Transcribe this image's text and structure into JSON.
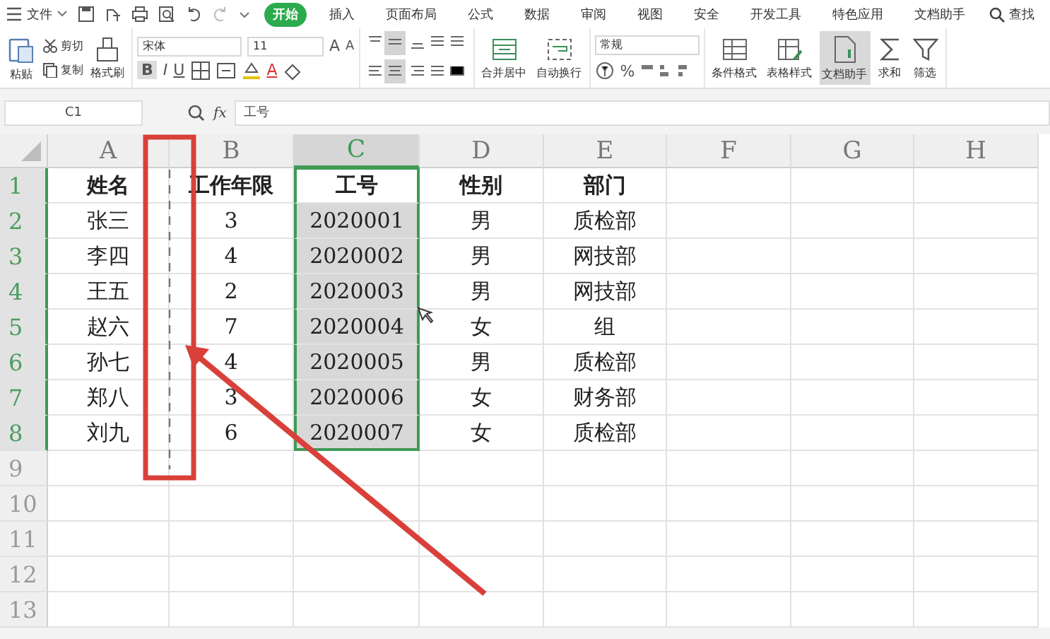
{
  "menu": {
    "file": "文件"
  },
  "tabs": [
    {
      "label": "开始",
      "selected": true
    },
    {
      "label": "插入",
      "selected": false
    },
    {
      "label": "页面布局",
      "selected": false
    },
    {
      "label": "公式",
      "selected": false
    },
    {
      "label": "数据",
      "selected": false
    },
    {
      "label": "审阅",
      "selected": false
    },
    {
      "label": "视图",
      "selected": false
    },
    {
      "label": "安全",
      "selected": false
    },
    {
      "label": "开发工具",
      "selected": false
    },
    {
      "label": "特色应用",
      "selected": false
    },
    {
      "label": "文档助手",
      "selected": false
    }
  ],
  "search": {
    "label": "查找"
  },
  "ribbon": {
    "paste": "粘贴",
    "cut": "剪切",
    "copy": "复制",
    "format_painter": "格式刷",
    "font": "宋体",
    "font_size": "11",
    "font_grow": "A",
    "font_shrink": "A",
    "bold": "B",
    "italic": "I",
    "underline": "U",
    "font_color": "A",
    "merge": "合并居中",
    "wrap": "自动换行",
    "number_format": "常规",
    "percent": "%",
    "conditional": "条件格式",
    "table_style": "表格样式",
    "doc_helper": {
      "label": "文档助手",
      "selected": true
    },
    "sum": "求和",
    "filter": "筛选"
  },
  "formula_bar": {
    "name_box": "C1",
    "fx": "fx",
    "formula": "工号"
  },
  "sheet": {
    "columns": [
      {
        "label": "A",
        "selected": false
      },
      {
        "label": "B",
        "selected": false
      },
      {
        "label": "C",
        "selected": true
      },
      {
        "label": "D",
        "selected": false
      },
      {
        "label": "E",
        "selected": false
      },
      {
        "label": "F",
        "selected": false
      },
      {
        "label": "G",
        "selected": false
      },
      {
        "label": "H",
        "selected": false
      }
    ],
    "rows": [
      {
        "number": "1",
        "selected": true,
        "bold": true,
        "cells": [
          "姓名",
          "工作年限",
          "工号",
          "性别",
          "部门"
        ]
      },
      {
        "number": "2",
        "selected": true,
        "bold": false,
        "cells": [
          "张三",
          "3",
          "2020001",
          "男",
          "质检部"
        ]
      },
      {
        "number": "3",
        "selected": true,
        "bold": false,
        "cells": [
          "李四",
          "4",
          "2020002",
          "男",
          "网技部"
        ]
      },
      {
        "number": "4",
        "selected": true,
        "bold": false,
        "cells": [
          "王五",
          "2",
          "2020003",
          "男",
          "网技部"
        ]
      },
      {
        "number": "5",
        "selected": true,
        "bold": false,
        "cells": [
          "赵六",
          "7",
          "2020004",
          "女",
          "组"
        ]
      },
      {
        "number": "6",
        "selected": true,
        "bold": false,
        "cells": [
          "孙七",
          "4",
          "2020005",
          "男",
          "质检部"
        ]
      },
      {
        "number": "7",
        "selected": true,
        "bold": false,
        "cells": [
          "郑八",
          "3",
          "2020006",
          "女",
          "财务部"
        ]
      },
      {
        "number": "8",
        "selected": true,
        "bold": false,
        "cells": [
          "刘九",
          "6",
          "2020007",
          "女",
          "质检部"
        ]
      },
      {
        "number": "9",
        "selected": false
      },
      {
        "number": "10",
        "selected": false
      },
      {
        "number": "11",
        "selected": false
      },
      {
        "number": "12",
        "selected": false
      },
      {
        "number": "13",
        "selected": false
      }
    ]
  }
}
